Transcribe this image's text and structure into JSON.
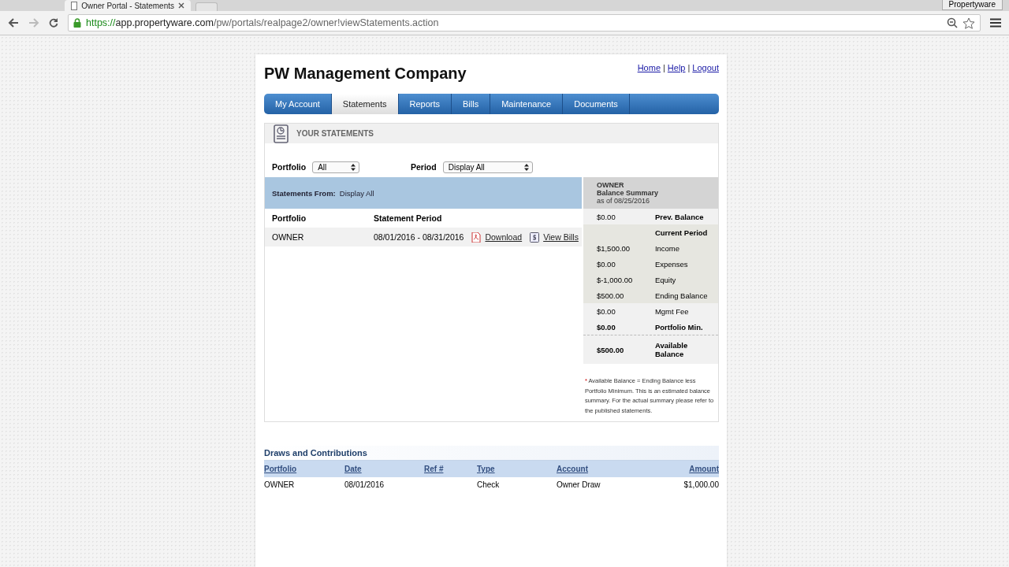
{
  "browser": {
    "tab_title": "Owner Portal - Statements",
    "profile": "Propertyware",
    "url_scheme": "https://",
    "url_host": "app.propertyware.com",
    "url_path": "/pw/portals/realpage2/owner!viewStatements.action"
  },
  "header": {
    "company": "PW Management Company",
    "links": [
      "Home",
      "Help",
      "Logout"
    ],
    "separator": "|"
  },
  "nav": [
    {
      "label": "My Account",
      "selected": false
    },
    {
      "label": "Statements",
      "selected": true
    },
    {
      "label": "Reports",
      "selected": false
    },
    {
      "label": "Bills",
      "selected": false
    },
    {
      "label": "Maintenance",
      "selected": false
    },
    {
      "label": "Documents",
      "selected": false
    }
  ],
  "section_title": "YOUR STATEMENTS",
  "filters": [
    {
      "label": "Portfolio",
      "value": "All"
    },
    {
      "label": "Period",
      "value": "Display All"
    }
  ],
  "statements": {
    "from_label": "Statements From:",
    "from_value": "Display All",
    "columns": [
      "Portfolio",
      "Statement Period"
    ],
    "rows": [
      {
        "portfolio": "OWNER",
        "period": "08/01/2016 - 08/31/2016",
        "download": "Download",
        "view_bills": "View Bills"
      }
    ]
  },
  "summary": {
    "owner": "OWNER",
    "title": "Balance Summary",
    "as_of": "as of 08/25/2016",
    "rows": [
      {
        "amount": "$0.00",
        "label": "Prev. Balance",
        "bold": false,
        "label_bold": true,
        "highlighted": false
      },
      {
        "label": "Current Period",
        "bold": false,
        "label_bold": true,
        "highlighted": true
      },
      {
        "amount": "$1,500.00",
        "label": "Income",
        "bold": false,
        "label_bold": false,
        "highlighted": true
      },
      {
        "amount": "$0.00",
        "label": "Expenses",
        "bold": false,
        "label_bold": false,
        "highlighted": true
      },
      {
        "amount": "$-1,000.00",
        "label": "Equity",
        "bold": false,
        "label_bold": false,
        "highlighted": true
      },
      {
        "amount": "$500.00",
        "label": "Ending Balance",
        "bold": false,
        "label_bold": false,
        "highlighted": true
      },
      {
        "amount": "$0.00",
        "label": "Mgmt Fee",
        "bold": false,
        "label_bold": false,
        "highlighted": false
      },
      {
        "amount": "$0.00",
        "label": "Portfolio Min.",
        "bold": true,
        "label_bold": true,
        "highlighted": false
      },
      {
        "amount": "$500.00",
        "label": "Available Balance",
        "bold": true,
        "label_bold": true,
        "highlighted": false,
        "divider": true
      }
    ],
    "note_mark": "*",
    "note": "Available Balance = Ending Balance less Portfolio Minimum. This is an estimated balance summary. For the actual summary please refer to the published statements."
  },
  "draws": {
    "title": "Draws and Contributions",
    "columns": [
      "Portfolio",
      "Date",
      "Ref #",
      "Type",
      "Account",
      "Amount"
    ],
    "rows": [
      [
        "OWNER",
        "08/01/2016",
        "",
        "Check",
        "Owner Draw",
        "$1,000.00"
      ]
    ]
  }
}
